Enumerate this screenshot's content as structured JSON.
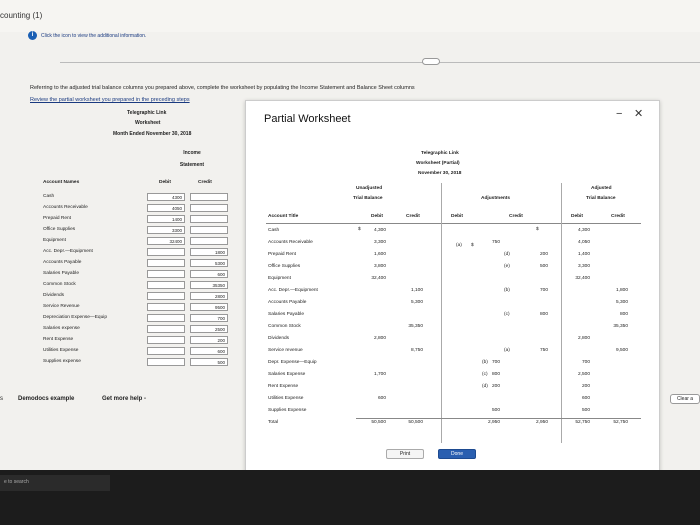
{
  "page": {
    "title": "counting (1)",
    "info_text": "Click the icon to view the additional information.",
    "instructions": "Referring to the adjusted trial balance columns you prepared above, complete the worksheet by populating the Income Statement and Balance Sheet columns",
    "review_link": "Review the partial worksheet you prepared in the preceding steps"
  },
  "left_ws": {
    "company": "Telegraphic Link",
    "title": "Worksheet",
    "date": "Month Ended November 30, 2018",
    "section": "Income Statement",
    "col_account": "Account Names",
    "col_debit": "Debit",
    "col_credit": "Credit",
    "accounts": [
      "Cash",
      "Accounts Receivable",
      "Prepaid Rent",
      "Office Supplies",
      "Equipment",
      "Acc. Depr.—Equipment",
      "Accounts Payable",
      "Salaries Payable",
      "Common Stock",
      "Dividends",
      "Service Revenue",
      "Depreciation Expense—Equip",
      "Salaries expense",
      "Rent Expense",
      "Utilities Expense",
      "Supplies expense"
    ],
    "debit_values": [
      "4300",
      "4050",
      "1400",
      "3300",
      "32400",
      "",
      "",
      "",
      "",
      "",
      "",
      "",
      "",
      "",
      "",
      ""
    ],
    "credit_values": [
      "",
      "",
      "",
      "",
      "",
      "1800",
      "5300",
      "600",
      "35350",
      "2800",
      "9500",
      "700",
      "2500",
      "200",
      "600",
      "500"
    ]
  },
  "popup": {
    "title": "Partial Worksheet",
    "company": "Telegraphic Link",
    "sheet": "Worksheet (Partial)",
    "date": "November 30, 2018",
    "h_unadjusted": "Unadjusted",
    "h_trial": "Trial Balance",
    "h_adjustments": "Adjustments",
    "h_adjusted": "Adjusted",
    "h_adj_trial": "Trial Balance",
    "h_account": "Account Title",
    "h_debit": "Debit",
    "h_credit": "Credit",
    "accounts": [
      "Cash",
      "Accounts Receivable",
      "Prepaid Rent",
      "Office Supplies",
      "Equipment",
      "Acc. Depr.—Equipment",
      "Accounts Payable",
      "Salaries Payable",
      "Common Stock",
      "Dividends",
      "Service revenue",
      "Depr. Expense—Equip",
      "Salaries Expense",
      "Rent Expense",
      "Utilities Expense",
      "Supplies Expense",
      "Total"
    ],
    "unadj_debit": [
      "4,300",
      "3,300",
      "1,600",
      "3,800",
      "32,400",
      "",
      "",
      "",
      "",
      "2,800",
      "",
      "",
      "1,700",
      "",
      "600",
      "",
      "50,500"
    ],
    "unadj_credit": [
      "",
      "",
      "",
      "",
      "",
      "1,100",
      "5,300",
      "",
      "35,350",
      "",
      "8,750",
      "",
      "",
      "",
      "",
      "",
      "50,500"
    ],
    "adj_debit_ref": [
      "",
      "",
      "",
      "",
      "",
      "",
      "",
      "",
      "",
      "",
      "",
      "(b)",
      "(c)",
      "(d)",
      "",
      "",
      ""
    ],
    "adj_debit": [
      "",
      "750",
      "",
      "",
      "",
      "",
      "",
      "",
      "",
      "",
      "",
      "700",
      "800",
      "200",
      "",
      "500",
      "2,950"
    ],
    "adj_credit_ref": [
      "",
      "",
      "(d)",
      "(e)",
      "",
      "(b)",
      "",
      "(c)",
      "",
      "",
      "(a)",
      "",
      "",
      "",
      "",
      "",
      ""
    ],
    "adj_credit": [
      "",
      "",
      "200",
      "500",
      "",
      "700",
      "",
      "800",
      "",
      "",
      "750",
      "",
      "",
      "",
      "",
      "",
      "2,950"
    ],
    "adjt_debit": [
      "4,300",
      "4,050",
      "1,400",
      "3,300",
      "32,400",
      "",
      "",
      "",
      "",
      "2,800",
      "",
      "700",
      "2,500",
      "200",
      "600",
      "500",
      "52,750"
    ],
    "adjt_credit": [
      "",
      "",
      "",
      "",
      "",
      "1,800",
      "5,300",
      "800",
      "35,350",
      "",
      "9,500",
      "",
      "",
      "",
      "",
      "",
      "52,750"
    ],
    "dollar": "$",
    "ref_a": "(a)",
    "print_label": "Print",
    "done_label": "Done"
  },
  "bottom": {
    "demo": "Demodocs example",
    "get_help": "Get more help -",
    "clear": "Clear a",
    "search": "e to search"
  }
}
